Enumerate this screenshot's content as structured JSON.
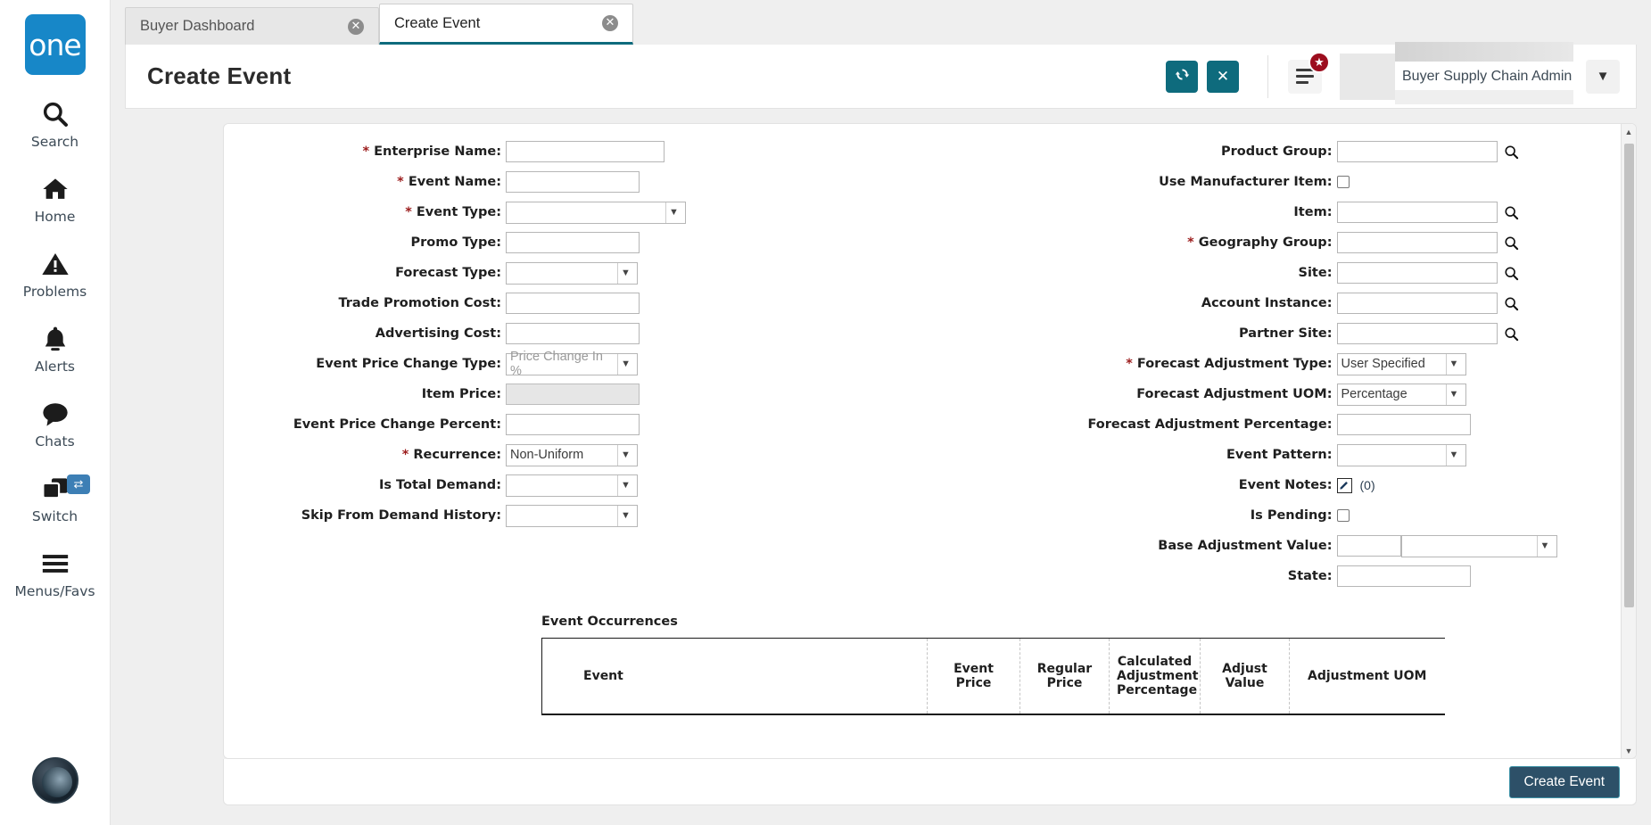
{
  "brand": {
    "logo_text": "one"
  },
  "sidebar": {
    "items": [
      {
        "label": "Search",
        "icon": "search-icon"
      },
      {
        "label": "Home",
        "icon": "home-icon"
      },
      {
        "label": "Problems",
        "icon": "warning-icon"
      },
      {
        "label": "Alerts",
        "icon": "bell-icon"
      },
      {
        "label": "Chats",
        "icon": "chat-icon"
      },
      {
        "label": "Switch",
        "icon": "switch-icon"
      },
      {
        "label": "Menus/Favs",
        "icon": "hamburger-icon"
      }
    ]
  },
  "tabs": [
    {
      "label": "Buyer Dashboard",
      "active": false
    },
    {
      "label": "Create Event",
      "active": true
    }
  ],
  "header": {
    "title": "Create Event",
    "refresh_icon": "refresh-icon",
    "close_icon": "close-icon",
    "menu_icon": "hamburger-menu-icon",
    "star_badge": "★",
    "user_name": "Buyer Supply Chain Admin",
    "chevron_icon": "chevron-down-icon",
    "accent_color": "#0e6b7d"
  },
  "form": {
    "left": [
      {
        "label": "Enterprise Name",
        "required": true,
        "type": "text",
        "value": "",
        "width": "w178"
      },
      {
        "label": "Event Name",
        "required": true,
        "type": "text",
        "value": "",
        "width": "w150"
      },
      {
        "label": "Event Type",
        "required": true,
        "type": "select",
        "value": "",
        "width": "w202"
      },
      {
        "label": "Promo Type",
        "required": false,
        "type": "text",
        "value": "",
        "width": "w150"
      },
      {
        "label": "Forecast Type",
        "required": false,
        "type": "select",
        "value": "",
        "width": "w148"
      },
      {
        "label": "Trade Promotion Cost",
        "required": false,
        "type": "text",
        "value": "",
        "width": "w150"
      },
      {
        "label": "Advertising Cost",
        "required": false,
        "type": "text",
        "value": "",
        "width": "w150"
      },
      {
        "label": "Event Price Change Type",
        "required": false,
        "type": "select",
        "value": "",
        "placeholder": "Price Change In %",
        "width": "w148"
      },
      {
        "label": "Item Price",
        "required": false,
        "type": "text",
        "value": "",
        "disabled": true,
        "width": "w150"
      },
      {
        "label": "Event Price Change Percent",
        "required": false,
        "type": "text",
        "value": "",
        "width": "w150"
      },
      {
        "label": "Recurrence",
        "required": true,
        "type": "select",
        "value": "Non-Uniform",
        "width": "w148"
      },
      {
        "label": "Is Total Demand",
        "required": false,
        "type": "select",
        "value": "",
        "width": "w148"
      },
      {
        "label": "Skip From Demand History",
        "required": false,
        "type": "select",
        "value": "",
        "width": "w148"
      }
    ],
    "right": [
      {
        "label": "Product Group",
        "required": false,
        "type": "lookup",
        "value": "",
        "width": "w180"
      },
      {
        "label": "Use Manufacturer Item",
        "required": false,
        "type": "checkbox",
        "checked": false
      },
      {
        "label": "Item",
        "required": false,
        "type": "lookup",
        "value": "",
        "width": "w180"
      },
      {
        "label": "Geography Group",
        "required": true,
        "type": "lookup",
        "value": "",
        "width": "w180"
      },
      {
        "label": "Site",
        "required": false,
        "type": "lookup",
        "value": "",
        "width": "w180"
      },
      {
        "label": "Account Instance",
        "required": false,
        "type": "lookup",
        "value": "",
        "width": "w180"
      },
      {
        "label": "Partner Site",
        "required": false,
        "type": "lookup",
        "value": "",
        "width": "w180"
      },
      {
        "label": "Forecast Adjustment Type",
        "required": true,
        "type": "select",
        "value": "User Specified",
        "width": "w145"
      },
      {
        "label": "Forecast Adjustment UOM",
        "required": false,
        "type": "select",
        "value": "Percentage",
        "width": "w145"
      },
      {
        "label": "Forecast Adjustment Percentage",
        "required": false,
        "type": "text",
        "value": "",
        "width": "w150"
      },
      {
        "label": "Event Pattern",
        "required": false,
        "type": "select",
        "value": "",
        "width": "w145"
      },
      {
        "label": "Event Notes",
        "required": false,
        "type": "notes",
        "count": "(0)",
        "icon": "edit-note-icon"
      },
      {
        "label": "Is Pending",
        "required": false,
        "type": "checkbox",
        "checked": false
      },
      {
        "label": "Base Adjustment Value",
        "required": false,
        "type": "value-unit",
        "value": "",
        "unit": "",
        "width": "w72"
      },
      {
        "label": "State",
        "required": false,
        "type": "text",
        "value": "",
        "width": "w150"
      }
    ]
  },
  "occurrences": {
    "title": "Event Occurrences",
    "columns": [
      "Event",
      "Event Price",
      "Regular Price",
      "Calculated Adjustment Percentage",
      "Adjust Value",
      "Adjustment UOM"
    ],
    "rows": []
  },
  "footer": {
    "submit_label": "Create Event"
  }
}
